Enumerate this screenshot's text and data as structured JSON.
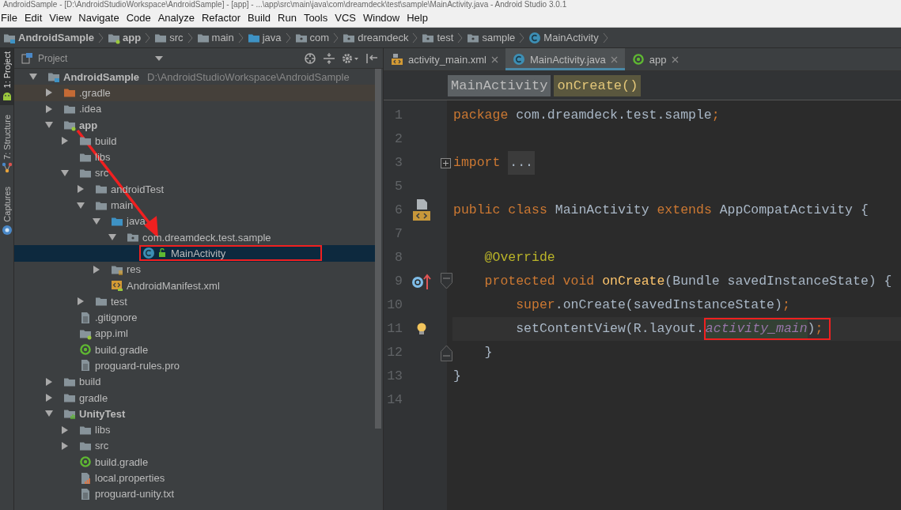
{
  "window": {
    "title": "AndroidSample - [D:\\AndroidStudioWorkspace\\AndroidSample] - [app] - ...\\app\\src\\main\\java\\com\\dreamdeck\\test\\sample\\MainActivity.java - Android Studio 3.0.1"
  },
  "menu": [
    "File",
    "Edit",
    "View",
    "Navigate",
    "Code",
    "Analyze",
    "Refactor",
    "Build",
    "Run",
    "Tools",
    "VCS",
    "Window",
    "Help"
  ],
  "nav_bar": [
    {
      "label": "AndroidSample",
      "kind": "project",
      "bold": true
    },
    {
      "label": "app",
      "kind": "module",
      "bold": true
    },
    {
      "label": "src",
      "kind": "folder",
      "bold": false
    },
    {
      "label": "main",
      "kind": "folder",
      "bold": false
    },
    {
      "label": "java",
      "kind": "source-folder",
      "bold": false
    },
    {
      "label": "com",
      "kind": "package-folder",
      "bold": false
    },
    {
      "label": "dreamdeck",
      "kind": "package-folder",
      "bold": false
    },
    {
      "label": "test",
      "kind": "package-folder",
      "bold": false
    },
    {
      "label": "sample",
      "kind": "package-folder",
      "bold": false
    },
    {
      "label": "MainActivity",
      "kind": "class",
      "bold": false
    }
  ],
  "side_tabs": [
    {
      "label": "1: Project",
      "kind": "android",
      "selected": true
    },
    {
      "label": "7: Structure",
      "kind": "structure",
      "selected": false
    },
    {
      "label": "Captures",
      "kind": "capture",
      "selected": false
    }
  ],
  "project_panel": {
    "view": "Project",
    "tree": [
      {
        "label": "AndroidSample",
        "path": "D:\\AndroidStudioWorkspace\\AndroidSample",
        "kind": "project",
        "bold": true,
        "expanded": true,
        "selected": false,
        "children": [
          {
            "label": ".gradle",
            "kind": "excluded-folder",
            "expanded": false,
            "excluded": true,
            "selected": false
          },
          {
            "label": ".idea",
            "kind": "folder",
            "expanded": false,
            "selected": false
          },
          {
            "label": "app",
            "kind": "module",
            "bold": true,
            "expanded": true,
            "selected": false,
            "children": [
              {
                "label": "build",
                "kind": "folder",
                "expanded": false,
                "selected": false
              },
              {
                "label": "libs",
                "kind": "folder",
                "selected": false
              },
              {
                "label": "src",
                "kind": "folder",
                "expanded": true,
                "selected": false,
                "children": [
                  {
                    "label": "androidTest",
                    "kind": "folder",
                    "expanded": false,
                    "selected": false
                  },
                  {
                    "label": "main",
                    "kind": "folder",
                    "expanded": true,
                    "selected": false,
                    "children": [
                      {
                        "label": "java",
                        "kind": "source-folder",
                        "expanded": true,
                        "selected": false,
                        "children": [
                          {
                            "label": "com.dreamdeck.test.sample",
                            "kind": "package-folder",
                            "expanded": true,
                            "selected": false,
                            "children": [
                              {
                                "label": "MainActivity",
                                "kind": "class",
                                "selected": true,
                                "annotated": true
                              }
                            ]
                          }
                        ]
                      },
                      {
                        "label": "res",
                        "kind": "res-folder",
                        "expanded": false,
                        "selected": false
                      },
                      {
                        "label": "AndroidManifest.xml",
                        "kind": "manifest",
                        "selected": false
                      }
                    ]
                  },
                  {
                    "label": "test",
                    "kind": "folder",
                    "expanded": false,
                    "selected": false
                  }
                ]
              },
              {
                "label": ".gitignore",
                "kind": "text-file",
                "selected": false
              },
              {
                "label": "app.iml",
                "kind": "module",
                "selected": false
              },
              {
                "label": "build.gradle",
                "kind": "gradle",
                "selected": false
              },
              {
                "label": "proguard-rules.pro",
                "kind": "text-file",
                "selected": false
              }
            ]
          },
          {
            "label": "build",
            "kind": "folder",
            "expanded": false,
            "selected": false
          },
          {
            "label": "gradle",
            "kind": "folder",
            "expanded": false,
            "selected": false
          },
          {
            "label": "UnityTest",
            "kind": "unity-module",
            "bold": true,
            "expanded": true,
            "selected": false,
            "children": [
              {
                "label": "libs",
                "kind": "folder",
                "expanded": false,
                "selected": false
              },
              {
                "label": "src",
                "kind": "folder",
                "expanded": false,
                "selected": false
              },
              {
                "label": "build.gradle",
                "kind": "gradle",
                "selected": false
              },
              {
                "label": "local.properties",
                "kind": "properties",
                "selected": false
              },
              {
                "label": "proguard-unity.txt",
                "kind": "text-file",
                "selected": false
              }
            ]
          }
        ]
      }
    ]
  },
  "editor": {
    "tabs": [
      {
        "label": "activity_main.xml",
        "kind": "layout-xml",
        "selected": false
      },
      {
        "label": "MainActivity.java",
        "kind": "class",
        "selected": true
      },
      {
        "label": "app",
        "kind": "gradle",
        "selected": false
      }
    ],
    "breadcrumbs": [
      {
        "label": "MainActivity",
        "kind": "class"
      },
      {
        "label": "onCreate()",
        "kind": "method"
      }
    ],
    "lines": [
      {
        "number": "1",
        "tokens": [
          {
            "kind": "keyword",
            "text": "package"
          },
          {
            "kind": "plain",
            "text": " com.dreamdeck.test.sample"
          },
          {
            "kind": "keyword",
            "text": ";"
          }
        ]
      },
      {
        "number": "2"
      },
      {
        "number": "3",
        "markers": [
          {
            "kind": "fold-expand"
          }
        ],
        "tokens": [
          {
            "kind": "keyword",
            "text": "import "
          },
          {
            "kind": "folded",
            "text": "..."
          }
        ]
      },
      {
        "number": "5"
      },
      {
        "number": "6",
        "markers": [
          {
            "kind": "layout"
          }
        ],
        "tokens": [
          {
            "kind": "keyword",
            "text": "public class "
          },
          {
            "kind": "plain",
            "text": "MainActivity "
          },
          {
            "kind": "keyword",
            "text": "extends "
          },
          {
            "kind": "plain",
            "text": "AppCompatActivity {"
          }
        ]
      },
      {
        "number": "7"
      },
      {
        "number": "8",
        "tokens": [
          {
            "kind": "annotation",
            "text": "    @Override"
          }
        ]
      },
      {
        "number": "9",
        "markers": [
          {
            "kind": "override"
          },
          {
            "kind": "fold-start"
          }
        ],
        "tokens": [
          {
            "kind": "keyword",
            "text": "    protected void "
          },
          {
            "kind": "method",
            "text": "onCreate"
          },
          {
            "kind": "plain",
            "text": "(Bundle savedInstanceState) {"
          }
        ]
      },
      {
        "number": "10",
        "tokens": [
          {
            "kind": "keyword",
            "text": "        super"
          },
          {
            "kind": "plain",
            "text": ".onCreate(savedInstanceState)"
          },
          {
            "kind": "keyword",
            "text": ";"
          }
        ]
      },
      {
        "number": "11",
        "markers": [
          {
            "kind": "bulb"
          }
        ],
        "current": true,
        "tokens": [
          {
            "kind": "plain",
            "text": "        setContentView(R.layout."
          },
          {
            "kind": "field",
            "text": "activity_main",
            "annotated": true
          },
          {
            "kind": "plain",
            "text": ")",
            "annotated": true
          },
          {
            "kind": "keyword",
            "text": ";",
            "annotated": true
          }
        ]
      },
      {
        "number": "12",
        "markers": [
          {
            "kind": "fold-end"
          }
        ],
        "tokens": [
          {
            "kind": "plain",
            "text": "    }"
          }
        ]
      },
      {
        "number": "13",
        "tokens": [
          {
            "kind": "plain",
            "text": "}"
          }
        ]
      },
      {
        "number": "14"
      }
    ]
  }
}
